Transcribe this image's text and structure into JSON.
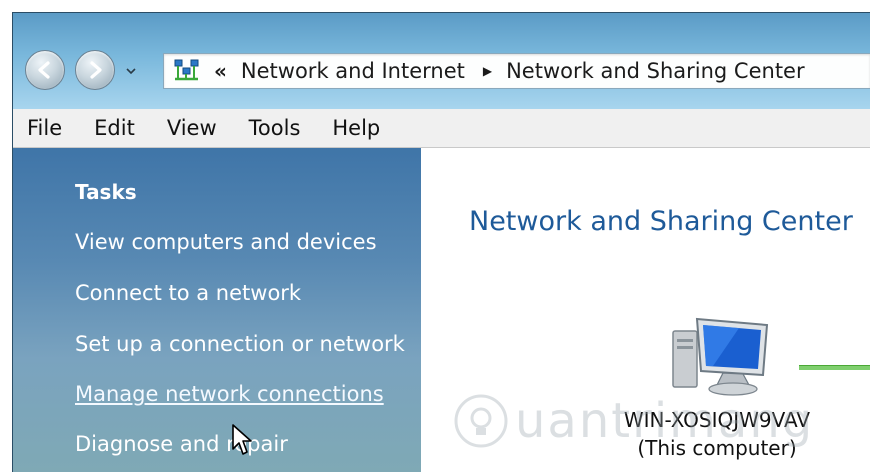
{
  "address_bar": {
    "crumbs": [
      "Network and Internet",
      "Network and Sharing Center"
    ],
    "separator": "«"
  },
  "menubar": {
    "items": [
      "File",
      "Edit",
      "View",
      "Tools",
      "Help"
    ]
  },
  "sidebar": {
    "heading": "Tasks",
    "items": [
      "View computers and devices",
      "Connect to a network",
      "Set up a connection or network",
      "Manage network connections",
      "Diagnose and repair"
    ]
  },
  "main": {
    "title": "Network and Sharing Center",
    "computer": {
      "name": "WIN-XOSIQJW9VAV",
      "label": "(This computer)"
    }
  },
  "watermark": {
    "text": "uantrimang"
  },
  "colors": {
    "link_blue": "#1e5a99",
    "sidebar_top": "#3f75a8",
    "connection_green": "#7fcf6e"
  }
}
